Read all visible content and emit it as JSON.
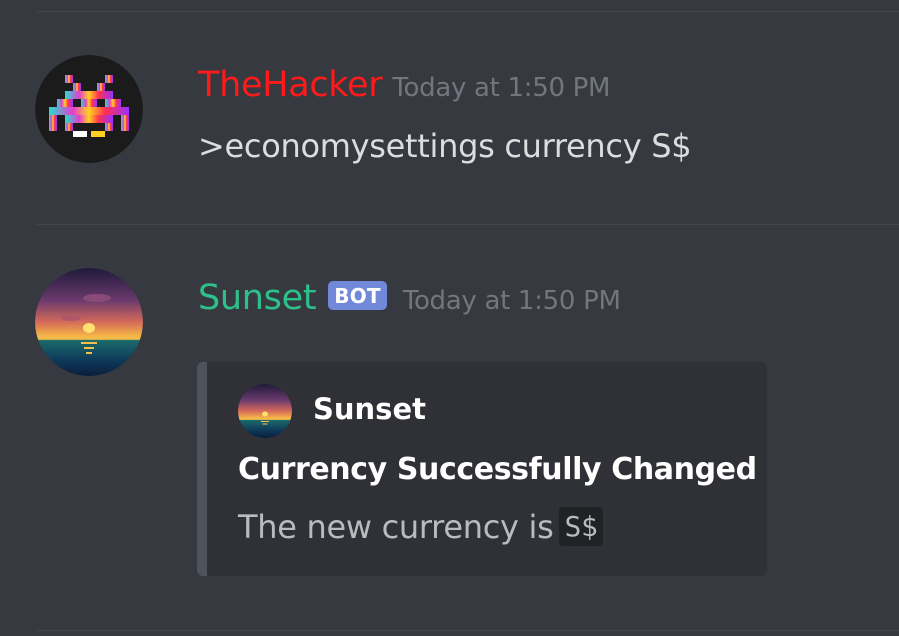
{
  "messages": [
    {
      "author": "TheHacker",
      "author_color": "#ff1a1a",
      "avatar_icon": "space-invader-icon",
      "timestamp": "Today at 1:50 PM",
      "content": ">economysettings currency S$"
    },
    {
      "author": "Sunset",
      "author_color": "#2ec08a",
      "avatar_icon": "sunset-avatar-icon",
      "bot_tag": "BOT",
      "bot_tag_color": "#7289da",
      "timestamp": "Today at 1:50 PM",
      "embed": {
        "author_name": "Sunset",
        "title": "Currency Successfully Changed",
        "description_prefix": "The new currency is",
        "description_code": "S$"
      }
    }
  ]
}
